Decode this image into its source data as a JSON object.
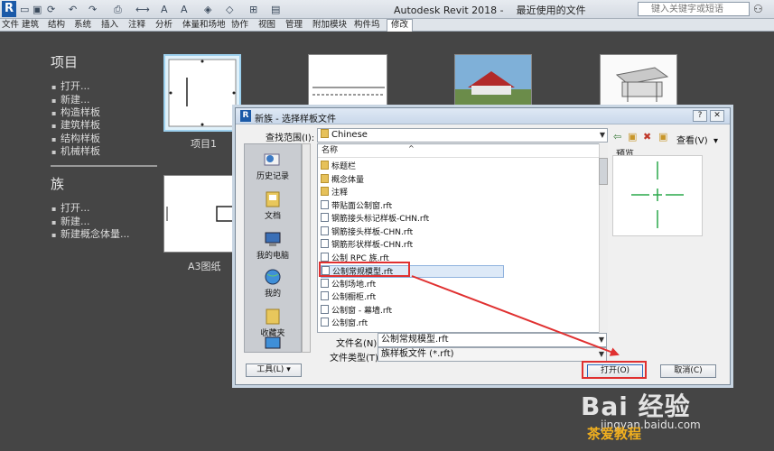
{
  "window": {
    "app_title": "Autodesk Revit 2018 -",
    "doc_title": "最近使用的文件",
    "search_placeholder": "键入关键字或短语"
  },
  "ribbon": {
    "tabs": [
      "文件",
      "建筑",
      "结构",
      "系统",
      "插入",
      "注释",
      "分析",
      "体量和场地",
      "协作",
      "视图",
      "管理",
      "附加模块",
      "构件坞",
      "修改"
    ],
    "active_tab": "修改"
  },
  "projects": {
    "title": "项目",
    "items": [
      "打开...",
      "新建...",
      "构造样板",
      "建筑样板",
      "结构样板",
      "机械样板"
    ],
    "thumbs": [
      "项目1"
    ]
  },
  "families": {
    "title": "族",
    "items": [
      "打开...",
      "新建...",
      "新建概念体量..."
    ],
    "thumbs": [
      "A3图纸"
    ]
  },
  "dialog": {
    "title": "新族 - 选择样板文件",
    "lookin_label": "查找范围(I):",
    "lookin_value": "Chinese",
    "column_name": "名称",
    "preview_label": "预览",
    "view_label": "查看(V)",
    "places": [
      "历史记录",
      "文档",
      "我的电脑",
      "我的",
      "收藏夹"
    ],
    "files": [
      {
        "name": "标题栏",
        "type": "folder"
      },
      {
        "name": "概念体量",
        "type": "folder"
      },
      {
        "name": "注释",
        "type": "folder"
      },
      {
        "name": "带贴面公制窗.rft",
        "type": "rft"
      },
      {
        "name": "钢筋接头标记样板-CHN.rft",
        "type": "rft"
      },
      {
        "name": "钢筋接头样板-CHN.rft",
        "type": "rft"
      },
      {
        "name": "钢筋形状样板-CHN.rft",
        "type": "rft"
      },
      {
        "name": "公制 RPC 族.rft",
        "type": "rft"
      },
      {
        "name": "公制常规模型.rft",
        "type": "rft",
        "selected": true
      },
      {
        "name": "公制场地.rft",
        "type": "rft"
      },
      {
        "name": "公制橱柜.rft",
        "type": "rft"
      },
      {
        "name": "公制窗 - 幕墙.rft",
        "type": "rft"
      },
      {
        "name": "公制窗.rft",
        "type": "rft"
      }
    ],
    "filename_label": "文件名(N):",
    "filename_value": "公制常规模型.rft",
    "filetype_label": "文件类型(T):",
    "filetype_value": "族样板文件 (*.rft)",
    "tools_label": "工具(L)",
    "open_label": "打开(O)",
    "cancel_label": "取消(C)"
  },
  "watermark": {
    "logo": "Bai 经验",
    "url": "jingyan.baidu.com",
    "corner": "茶爱教程"
  },
  "colors": {
    "annotation": "#e03030",
    "background": "#454545"
  }
}
